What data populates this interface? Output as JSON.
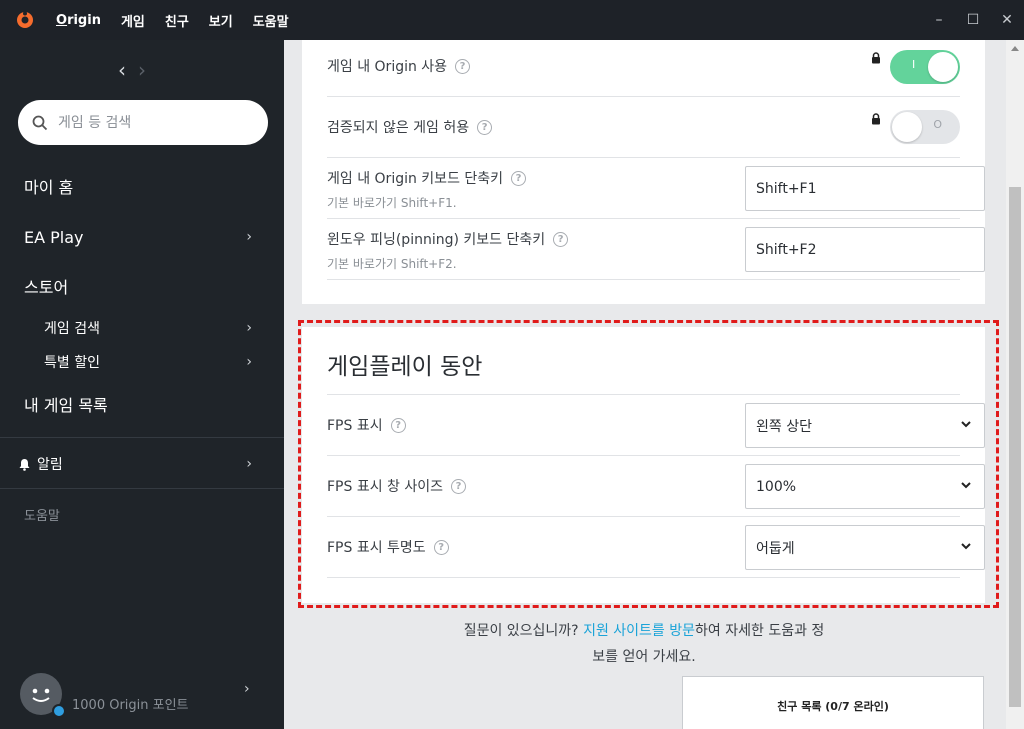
{
  "titlebar": {
    "menu": {
      "origin_first": "O",
      "origin_rest": "rigin",
      "game": "게임",
      "friends": "친구",
      "view": "보기",
      "help": "도움말"
    },
    "controls": {
      "minimize": "–",
      "maximize": "☐",
      "close": "✕"
    }
  },
  "sidebar": {
    "search_placeholder": "게임 등 검색",
    "nav": {
      "home": "마이 홈",
      "ea_play": "EA Play",
      "store": "스토어",
      "browse_games": "게임 검색",
      "deals": "특별 할인",
      "my_games": "내 게임 목록",
      "alerts": "알림",
      "help": "도움말"
    },
    "points": "1000 Origin 포인트"
  },
  "settings": {
    "ingame_origin": {
      "label": "게임 내 Origin 사용",
      "toggle": "I"
    },
    "unverified": {
      "label": "검증되지 않은 게임 허용",
      "toggle": "O"
    },
    "shortcut": {
      "label": "게임 내 Origin 키보드 단축키",
      "sub": "기본 바로가기 Shift+F1.",
      "value": "Shift+F1"
    },
    "pinning": {
      "label": "윈도우 피닝(pinning) 키보드 단축키",
      "sub": "기본 바로가기 Shift+F2.",
      "value": "Shift+F2"
    }
  },
  "gameplay": {
    "title": "게임플레이 동안",
    "fps_display": {
      "label": "FPS 표시",
      "value": "왼쪽 상단"
    },
    "fps_size": {
      "label": "FPS 표시 창 사이즈",
      "value": "100%"
    },
    "fps_opacity": {
      "label": "FPS 표시 투명도",
      "value": "어둡게"
    }
  },
  "footer": {
    "q_prefix": "질문이 있으십니까? ",
    "q_link": "지원 사이트를 방문",
    "q_suffix_line1": "하여 자세한 도움과 정",
    "q_line2": "보를 얻어 가세요.",
    "friends_list": "친구 목록 (0/7 온라인)"
  },
  "icons": {
    "help": "?",
    "lock": "🔒",
    "chevron": "›",
    "back": "‹",
    "forward": "›"
  },
  "colors": {
    "accent_toggle": "#63d39b",
    "link": "#1aa3d8",
    "highlight": "#e01b1b",
    "brand": "#f56c2d"
  }
}
